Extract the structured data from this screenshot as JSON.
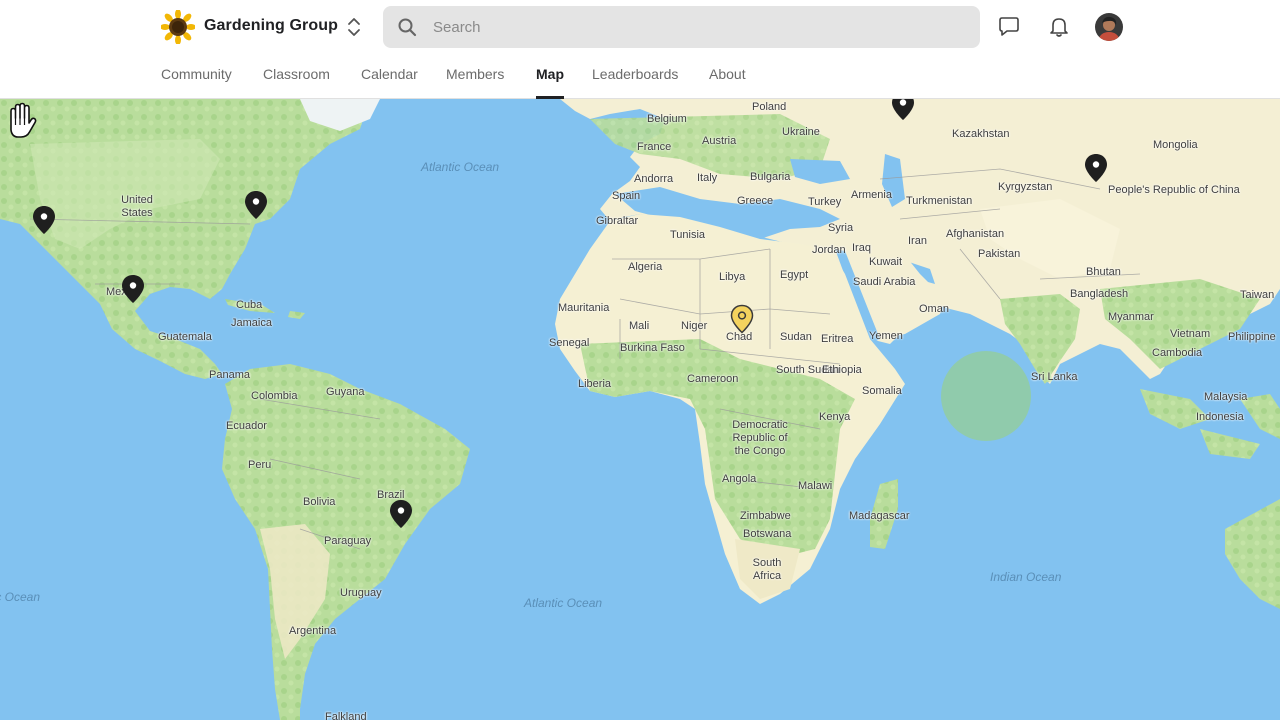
{
  "header": {
    "group_name": "Gardening Group",
    "search_placeholder": "Search",
    "search_value": "",
    "icons": {
      "logo": "sunflower-icon",
      "switcher": "chevron-up-down-icon",
      "search": "search-icon",
      "chat": "chat-bubble-icon",
      "notifications": "bell-icon",
      "avatar": "user-avatar"
    }
  },
  "nav": {
    "tabs": [
      {
        "label": "Community"
      },
      {
        "label": "Classroom"
      },
      {
        "label": "Calendar"
      },
      {
        "label": "Members"
      },
      {
        "label": "Map",
        "active": true
      },
      {
        "label": "Leaderboards"
      },
      {
        "label": "About"
      }
    ]
  },
  "map": {
    "oceans": {
      "atlantic_north": "Atlantic Ocean",
      "atlantic_south": "Atlantic Ocean",
      "indian": "Indian Ocean",
      "pacific": "Pacific Ocean"
    },
    "countries": {
      "poland": "Poland",
      "belgium": "Belgium",
      "ukraine": "Ukraine",
      "france": "France",
      "austria": "Austria",
      "andorra": "Andorra",
      "italy": "Italy",
      "bulgaria": "Bulgaria",
      "spain": "Spain",
      "greece": "Greece",
      "turkey": "Turkey",
      "armenia": "Armenia",
      "gibraltar": "Gibraltar",
      "tunisia": "Tunisia",
      "syria": "Syria",
      "kazakhstan": "Kazakhstan",
      "mongolia": "Mongolia",
      "kyrgyzstan": "Kyrgyzstan",
      "turkmenistan": "Turkmenistan",
      "iran": "Iran",
      "afghanistan": "Afghanistan",
      "pakistan": "Pakistan",
      "china": "People's Republic of China",
      "jordan": "Jordan",
      "kuwait": "Kuwait",
      "iraq": "Iraq",
      "algeria": "Algeria",
      "libya": "Libya",
      "egypt": "Egypt",
      "saudi_arabia": "Saudi Arabia",
      "oman": "Oman",
      "bhutan": "Bhutan",
      "bangladesh": "Bangladesh",
      "taiwan": "Taiwan",
      "mauritania": "Mauritania",
      "mali": "Mali",
      "niger": "Niger",
      "chad": "Chad",
      "sudan": "Sudan",
      "eritrea": "Eritrea",
      "yemen": "Yemen",
      "myanmar": "Myanmar",
      "vietnam": "Vietnam",
      "philippines": "Philippine",
      "senegal": "Senegal",
      "burkina_faso": "Burkina Faso",
      "cambodia": "Cambodia",
      "liberia": "Liberia",
      "cameroon": "Cameroon",
      "south_sudan": "South Sudan",
      "ethiopia": "Ethiopia",
      "sri_lanka": "Sri Lanka",
      "somalia": "Somalia",
      "malaysia": "Malaysia",
      "indonesia": "Indonesia",
      "kenya": "Kenya",
      "drc": "Democratic Republic of the Congo",
      "angola": "Angola",
      "malawi": "Malawi",
      "madagascar": "Madagascar",
      "zimbabwe": "Zimbabwe",
      "botswana": "Botswana",
      "south_africa": "South Africa",
      "united_states": "United States",
      "mexico": "Mexico",
      "cuba": "Cuba",
      "jamaica": "Jamaica",
      "guatemala": "Guatemala",
      "panama": "Panama",
      "colombia": "Colombia",
      "guyana": "Guyana",
      "ecuador": "Ecuador",
      "peru": "Peru",
      "brazil": "Brazil",
      "bolivia": "Bolivia",
      "paraguay": "Paraguay",
      "uruguay": "Uruguay",
      "argentina": "Argentina",
      "falkland": "Falkland"
    },
    "pin_icon": "map-pin-icon",
    "highlighted_pin_icon": "map-pin-highlighted-icon",
    "cursor_icon": "grab-hand-icon",
    "colors": {
      "water": "#82c2f0",
      "land": "#f5f1d8",
      "vegetation": "#b6dd9a",
      "border": "#9a9a9a",
      "pin": "#1f1f1f",
      "pin_highlight": "#f4d35e",
      "cursor_halo": "#93cca0"
    }
  }
}
